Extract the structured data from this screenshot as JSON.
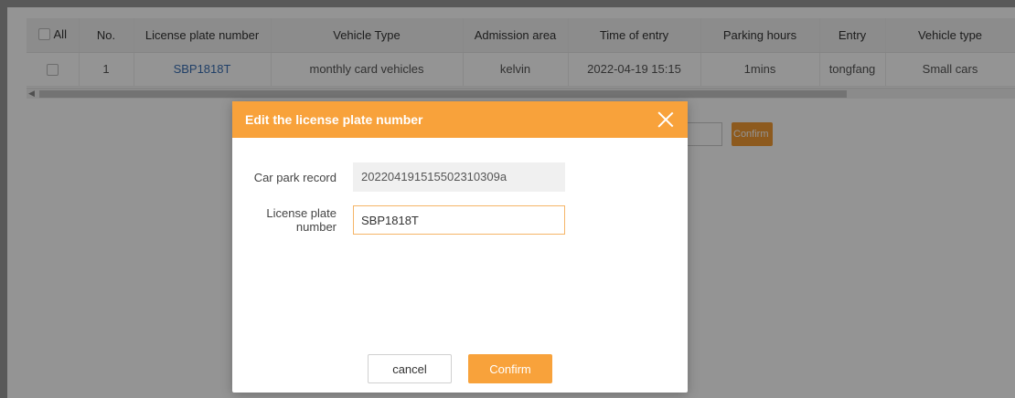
{
  "table": {
    "select_all_label": "All",
    "columns": [
      "No.",
      "License plate number",
      "Vehicle Type",
      "Admission area",
      "Time of entry",
      "Parking hours",
      "Entry",
      "Vehicle type"
    ],
    "rows": [
      {
        "no": "1",
        "plate": "SBP1818T",
        "vehicle_type": "monthly card vehicles",
        "admission_area": "kelvin",
        "time_of_entry": "2022-04-19 15:15",
        "parking_hours": "1mins",
        "entry": "tongfang",
        "vehicle_size": "Small cars"
      }
    ]
  },
  "background": {
    "confirm_label": "Confirm"
  },
  "modal": {
    "title": "Edit the license plate number",
    "fields": {
      "record_label": "Car park record",
      "record_value": "202204191515502310309a",
      "plate_label": "License plate number",
      "plate_value": "SBP1818T"
    },
    "buttons": {
      "cancel": "cancel",
      "confirm": "Confirm"
    }
  },
  "colors": {
    "accent": "#f8a23b",
    "link": "#3a6fb3",
    "overlay": "rgba(0,0,0,0.42)"
  },
  "icons": {
    "close": "close-icon",
    "scroll_left": "scroll-left-arrow-icon"
  }
}
